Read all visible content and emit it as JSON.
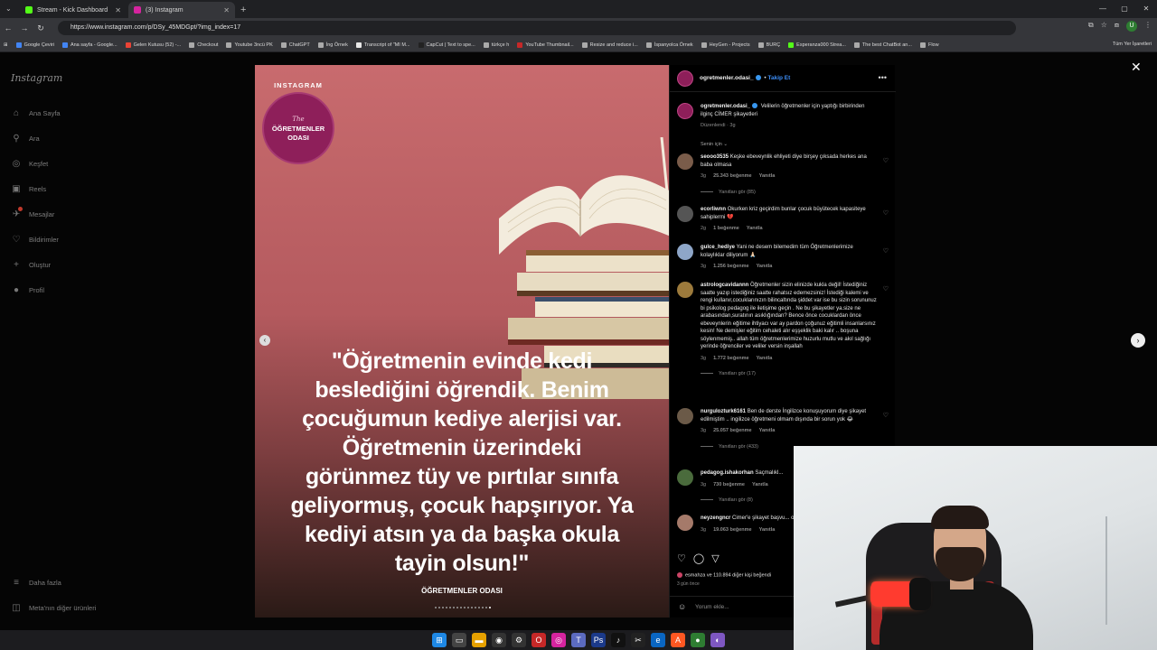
{
  "browser": {
    "tabs": [
      {
        "title": "Stream - Kick Dashboard",
        "favicon_color": "#53fc18",
        "active": false
      },
      {
        "title": "(3) Instagram",
        "favicon_color": "#d6249f",
        "active": true
      }
    ],
    "new_tab": "+",
    "url": "https://www.instagram.com/p/DSy_45MDGpt/?img_index=17",
    "profile_initial": "U",
    "bookmarks": [
      "Google Çeviri",
      "Ana sayfa - Google...",
      "Gelen Kutusu (52) -...",
      "Checkout",
      "Youtube 3ncü PK",
      "ChatGPT",
      "İng Örnek",
      "Transcript of \"MI M...",
      "CapCut | Text to spe...",
      "türkçe h",
      "YouTube Thumbnail...",
      "Resize and reduce i...",
      "İspanyolca Örnek",
      "HeyGen - Projects",
      "BURÇ",
      "Esperanza000 Strea...",
      "The best ChatBot an...",
      "Flow"
    ],
    "bookmarks_right": "Tüm Yer İşaretleri"
  },
  "sidebar": {
    "logo": "Instagram",
    "items": [
      {
        "label": "Ana Sayfa",
        "icon": "home-icon",
        "glyph": "⌂"
      },
      {
        "label": "Ara",
        "icon": "search-icon",
        "glyph": "⚲"
      },
      {
        "label": "Keşfet",
        "icon": "compass-icon",
        "glyph": "◎"
      },
      {
        "label": "Reels",
        "icon": "reels-icon",
        "glyph": "▣"
      },
      {
        "label": "Mesajlar",
        "icon": "messages-icon",
        "glyph": "✈"
      },
      {
        "label": "Bildirimler",
        "icon": "heart-icon",
        "glyph": "♡"
      },
      {
        "label": "Oluştur",
        "icon": "plus-icon",
        "glyph": "+"
      },
      {
        "label": "Profil",
        "icon": "profile-icon",
        "glyph": "●"
      }
    ],
    "more": "Daha fazla",
    "meta": "Meta'nın diğer ürünleri"
  },
  "post": {
    "badge_top": "INSTAGRAM",
    "badge_the": "The",
    "badge_line1": "ÖĞRETMENLER",
    "badge_line2": "ODASI",
    "quote_lines": [
      "\"Öğretmenin evinde kedi",
      "beslediğini öğrendik. Benim",
      "çocuğumun kediye alerjisi var.",
      "Öğretmenin üzerindeki",
      "görünmez tüy ve pırtılar sınıfa",
      "geliyormuş, çocuk hapşırıyor. Ya",
      "kediyi atsın ya da başka okula",
      "tayin olsun!\""
    ],
    "brand": "ÖĞRETMENLER ODASI",
    "carousel_count": 16,
    "carousel_active": 16
  },
  "panel": {
    "username": "ogretmenler.odasi_",
    "follow": "Takip Et",
    "caption_user": "ogretmenler.odasi_",
    "caption": "Velilerin öğretmenler için yaptığı birbirinden ilginç CİMER şikayetleri",
    "caption_meta": "Düzenlendi · 3g",
    "sort": "Senin için",
    "comments": [
      {
        "user": "seooo3535",
        "text": "Keşke ebeveynlik ehliyeti diye birşey çıksada herkes ana baba olmasa",
        "age": "3g",
        "likes": "25.343 beğenme",
        "reply": "Yanıtla",
        "replies": "Yanıtları gör (85)",
        "av_color": "#7a5c4a"
      },
      {
        "user": "ecorliwnn",
        "text": "Okurken kriz geçirdim bunlar çocuk büyütecek kapasiteye sahiplermi 💔",
        "age": "2g",
        "likes": "1 beğenme",
        "reply": "Yanıtla",
        "replies": "",
        "av_color": "#555"
      },
      {
        "user": "gulce_hediye",
        "text": "Yani ne desem bilemedim tüm Öğretmenlerimize kolaylıklar diliyorum 🙏🏻",
        "age": "3g",
        "likes": "1.256 beğenme",
        "reply": "Yanıtla",
        "replies": "",
        "av_color": "#8ea6c8"
      },
      {
        "user": "astrologcavidannn",
        "text": "Öğretmenler sizin elinizde kukla değil! İstediğiniz saatte yazıp istediğiniz saatte rahatsız edemezsiniz! İstediği kalemi ve rengi kullanır,cocuklarınızın bilincaltında şiddet var ise bu sizin sorununuz bi psikolog pedagog ile iletişime geçin . Ne bu şikayetler ya.size ne arabasından,suratının asıklığından? Bence önce cocuklardan önce ebeveynlerin eğitime ihtiyacı var ay pardon çoğunuz eğitimli insanlarsınız kesin! Ne demişler eğitim cehaleti alır eşşeklik baki kalır .. boşuna söylenmemiş.. allah tüm öğretmenlerimize huzurlu mutlu ve akıl sağlığı yerinde öğrenciler ve veliler versin inşallah",
        "age": "3g",
        "likes": "1.772 beğenme",
        "reply": "Yanıtla",
        "replies": "Yanıtları gör (17)",
        "av_color": "#9c7a3c"
      },
      {
        "user": "nurgulozturk6161",
        "text": "Ben de derste İngilizce konuşuyorum diye şikayet edilmiştim .. ingilizce öğretmeni olmam dışında bir sorun yok 😂",
        "age": "3g",
        "likes": "25.057 beğenme",
        "reply": "Yanıtla",
        "replies": "Yanıtları gör (433)",
        "av_color": "#6b5a48"
      },
      {
        "user": "pedagog.ishakorhan",
        "text": "Saçmalıkl...",
        "age": "3g",
        "likes": "730 beğenme",
        "reply": "Yanıtla",
        "replies": "Yanıtları gör (8)",
        "av_color": "#4a6b3c"
      },
      {
        "user": "neyzengncr",
        "text": "Cimer'e şikayet başvu... olur mu",
        "age": "3g",
        "likes": "19.063 beğenme",
        "reply": "Yanıtla",
        "replies": "",
        "av_color": "#a57a6a"
      }
    ],
    "likes_line": "esmahza ve 110.894 diğer kişi beğendi",
    "ago": "3 gün önce",
    "add_comment": "Yorum ekle..."
  }
}
